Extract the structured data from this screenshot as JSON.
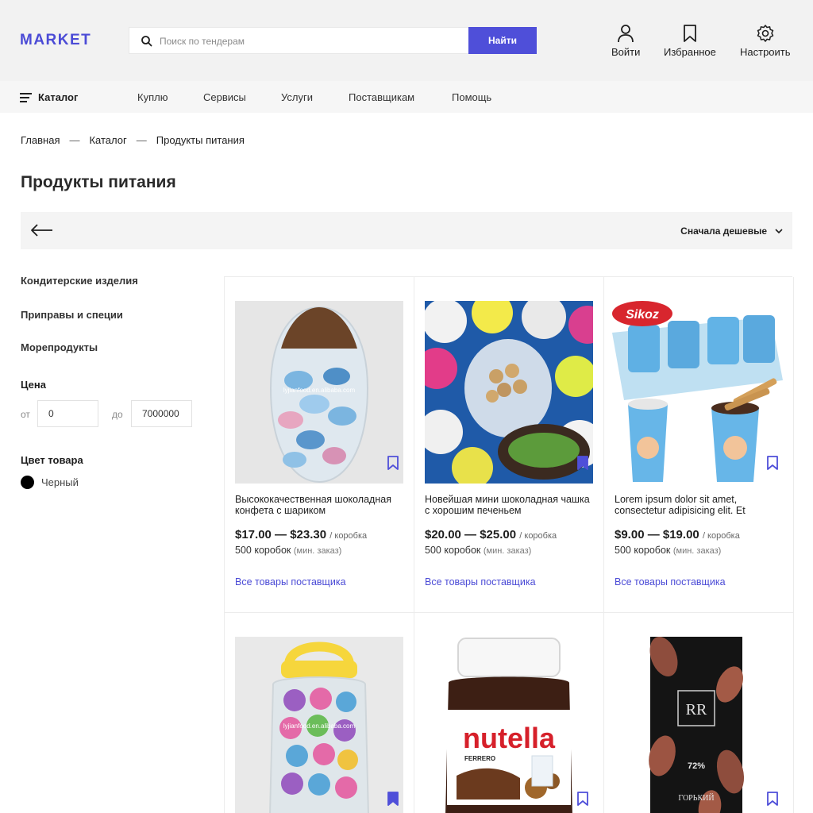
{
  "header": {
    "logo": "MARKET",
    "search_placeholder": "Поиск по тендерам",
    "search_button": "Найти",
    "actions": [
      {
        "label": "Войти",
        "icon": "user-icon"
      },
      {
        "label": "Избранное",
        "icon": "bookmark-icon"
      },
      {
        "label": "Настроить",
        "icon": "gear-icon"
      }
    ]
  },
  "nav": {
    "catalog": "Каталог",
    "items": [
      "Куплю",
      "Сервисы",
      "Услуги",
      "Поставщикам",
      "Помощь"
    ]
  },
  "breadcrumb": [
    "Главная",
    "Каталог",
    "Продукты питания"
  ],
  "breadcrumb_separator": "—",
  "page_title": "Продукты питания",
  "toolbar": {
    "sort_label": "Сначала дешевые"
  },
  "sidebar": {
    "categories": [
      "Кондитерские изделия",
      "Приправы и специи",
      "Морепродукты"
    ],
    "price": {
      "heading": "Цена",
      "from_label": "от",
      "to_label": "до",
      "from_value": "0",
      "to_value": "7000000"
    },
    "color": {
      "heading": "Цвет товара",
      "options": [
        {
          "label": "Черный",
          "hex": "#000000"
        }
      ]
    }
  },
  "products": [
    {
      "title": "Высококачественная шоколадная конфета с шариком",
      "price": "$17.00 — $23.30",
      "unit": "/ коробка",
      "moq": "500 коробок",
      "moq_note": "(мин. заказ)",
      "supplier_link": "Все товары поставщика",
      "image_text": "lyjianfood.en.alibaba.com",
      "bookmarked": false
    },
    {
      "title": "Новейшая мини шоколадная чашка с хорошим печеньем",
      "price": "$20.00 — $25.00",
      "unit": "/ коробка",
      "moq": "500 коробок",
      "moq_note": "(мин. заказ)",
      "supplier_link": "Все товары поставщика",
      "image_text": "",
      "bookmarked": true
    },
    {
      "title": "Lorem ipsum dolor sit amet, consectetur adipisicing elit. Et",
      "price": "$9.00 — $19.00",
      "unit": "/ коробка",
      "moq": "500 коробок",
      "moq_note": "(мин. заказ)",
      "supplier_link": "Все товары поставщика",
      "image_text": "Sikoz",
      "bookmarked": false
    },
    {
      "image_text": "lyjianfood.en.alibaba.com",
      "bookmarked": true
    },
    {
      "image_text": "nutella",
      "image_subtext": "FERRERO",
      "bookmarked": false
    },
    {
      "image_text": "72%",
      "image_subtext": "ГОРЬКИЙ",
      "bookmarked": false
    }
  ],
  "colors": {
    "accent": "#4f4fd9",
    "header_bg": "#f2f2f2",
    "nav_bg": "#f6f6f6",
    "link": "#4b4bd6"
  }
}
